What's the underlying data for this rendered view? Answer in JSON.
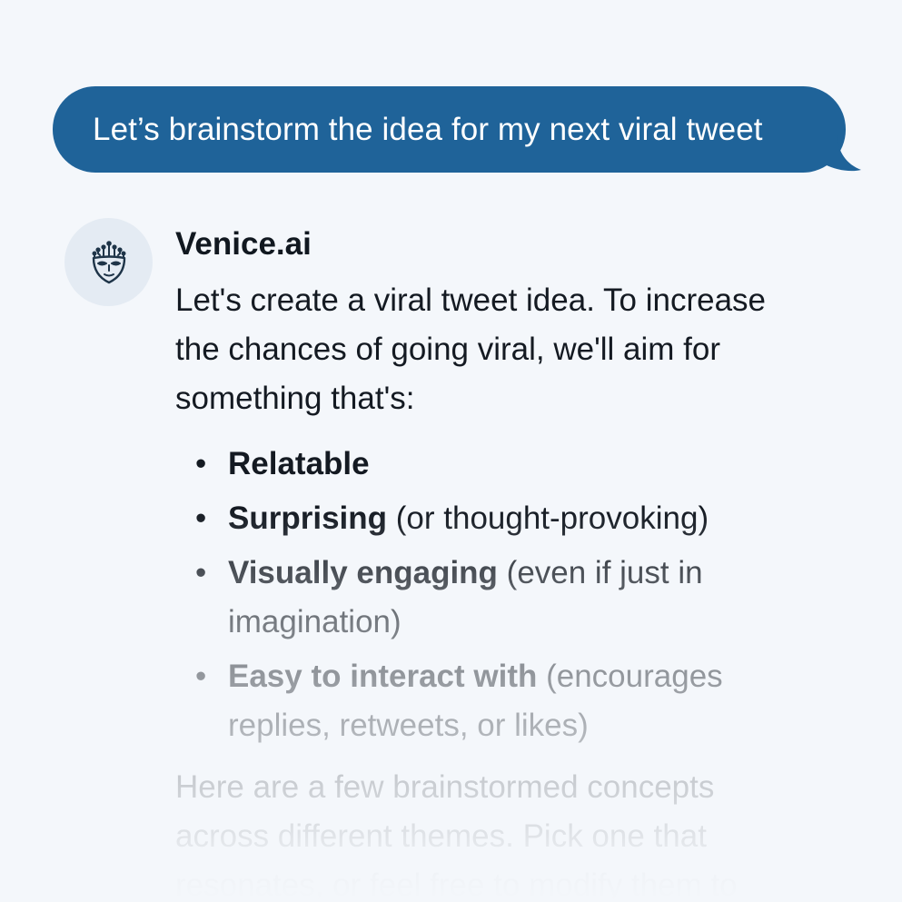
{
  "user_message": {
    "text": "Let’s brainstorm the idea for my next viral tweet"
  },
  "assistant": {
    "name": "Venice.ai",
    "avatar_icon": "venice-mask-icon",
    "intro": "Let's create a viral tweet idea. To increase the chances of going viral, we'll aim for something that's:",
    "bullets": [
      {
        "bold": "Relatable",
        "rest": ""
      },
      {
        "bold": "Surprising",
        "rest": " (or thought-provoking)"
      },
      {
        "bold": "Visually engaging",
        "rest": " (even if just in imagination)"
      },
      {
        "bold": "Easy to interact with",
        "rest": " (encourages replies, retweets, or likes)"
      }
    ],
    "followup": "Here are a few brainstormed concepts across different themes. Pick one that resonates, or feel free to modify them to"
  },
  "colors": {
    "background": "#f4f7fb",
    "user_bubble": "#1f6399",
    "avatar_bg": "#e4ebf3",
    "text": "#141a22"
  }
}
